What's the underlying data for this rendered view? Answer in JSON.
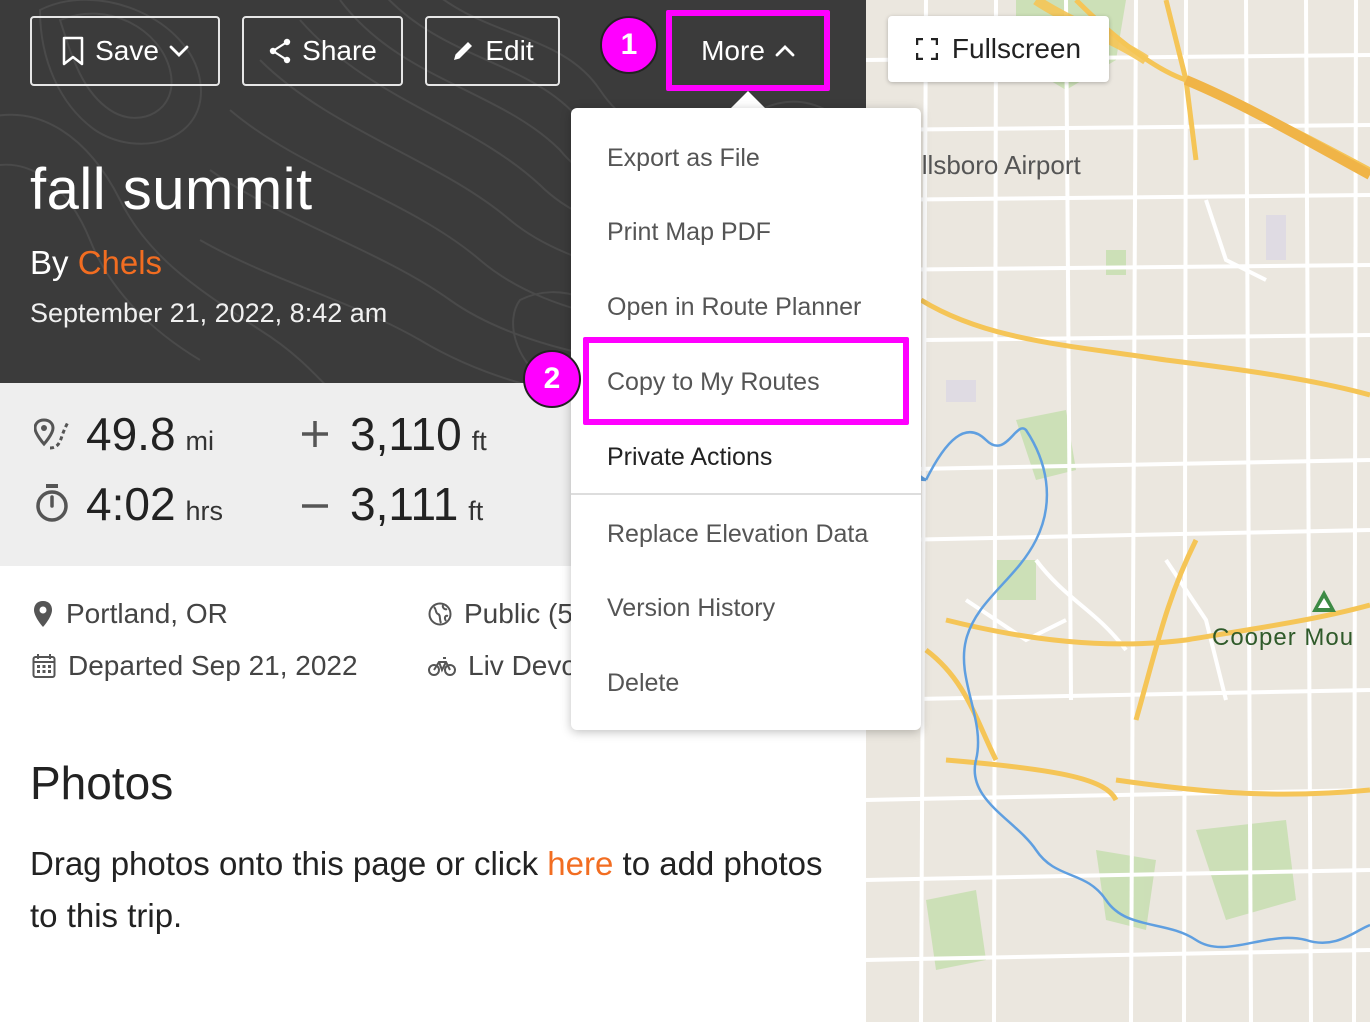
{
  "toolbar": {
    "save_label": "Save",
    "share_label": "Share",
    "edit_label": "Edit",
    "more_label": "More"
  },
  "trip": {
    "title": "fall summit",
    "by_prefix": "By",
    "author": "Chels",
    "datetime": "September 21, 2022, 8:42 am"
  },
  "stats": {
    "distance": {
      "value": "49.8",
      "unit": "mi"
    },
    "duration": {
      "value": "4:02",
      "unit": "hrs"
    },
    "elevation_gain": {
      "value": "3,110",
      "unit": "ft"
    },
    "elevation_loss": {
      "value": "3,111",
      "unit": "ft"
    }
  },
  "details": {
    "location": "Portland, OR",
    "departed": "Departed Sep 21, 2022",
    "privacy": "Public (5",
    "bike": "Liv Devo"
  },
  "photos": {
    "heading": "Photos",
    "text_before": "Drag photos onto this page or click ",
    "link": "here",
    "text_after": " to add photos to this trip."
  },
  "map": {
    "fullscreen_label": "Fullscreen",
    "label_airport": "illsboro Airport",
    "label_park": "Cooper Mou",
    "colors": {
      "background": "#ebe7df",
      "road": "#ffffff",
      "highway": "#f5c557",
      "water": "#5f9fe0",
      "park": "#c9dfb3"
    }
  },
  "menu": {
    "items": [
      "Export as File",
      "Print Map PDF",
      "Open in Route Planner",
      "Copy to My Routes"
    ],
    "section_label": "Private Actions",
    "private_items": [
      "Replace Elevation Data",
      "Version History",
      "Delete"
    ]
  },
  "annotations": {
    "step1": "1",
    "step2": "2",
    "highlight_color": "#ff00ff"
  },
  "accent_color": "#f26d21"
}
